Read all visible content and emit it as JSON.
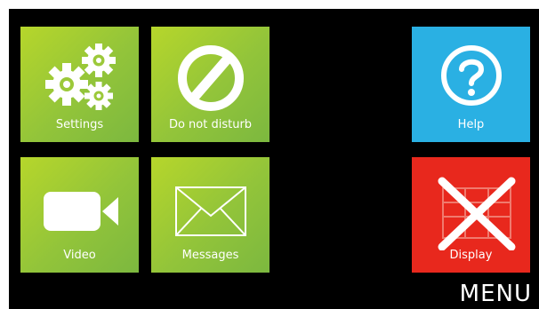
{
  "tiles": {
    "settings": {
      "label": "Settings",
      "icon": "gears-icon",
      "color": "#9cc93a"
    },
    "do_not_disturb": {
      "label": "Do not disturb",
      "icon": "no-entry-icon",
      "color": "#9cc93a"
    },
    "video": {
      "label": "Video",
      "icon": "video-camera-icon",
      "color": "#9cc93a"
    },
    "messages": {
      "label": "Messages",
      "icon": "envelope-icon",
      "color": "#9cc93a"
    },
    "help": {
      "label": "Help",
      "icon": "question-icon",
      "color": "#2ab0e3"
    },
    "display": {
      "label": "Display",
      "icon": "display-crossed-icon",
      "color": "#e8281d"
    }
  },
  "menu": {
    "title": "MENU"
  }
}
